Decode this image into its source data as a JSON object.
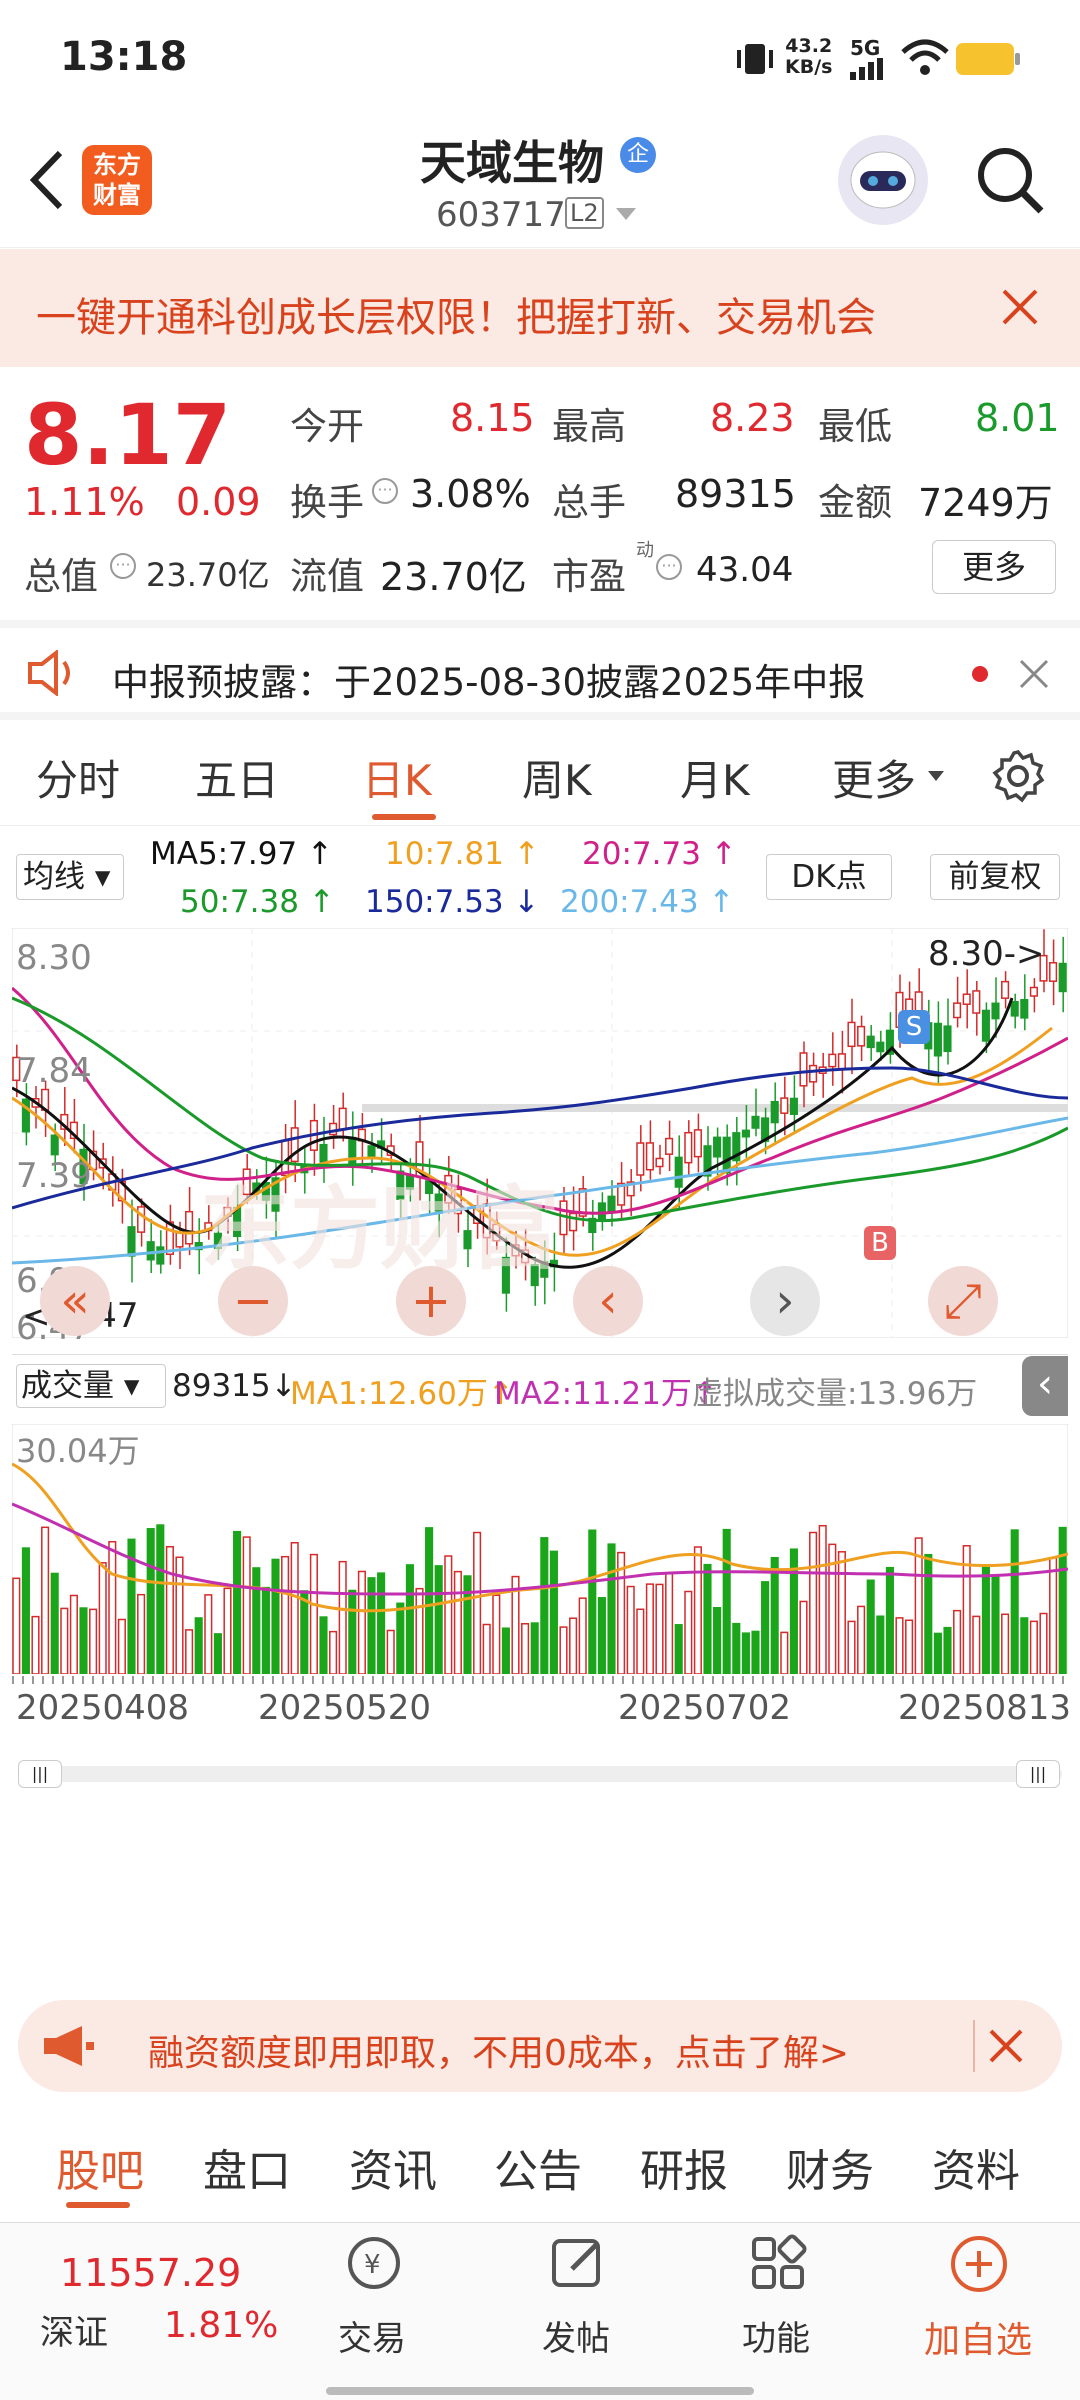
{
  "status": {
    "time": "13:18",
    "speed_top": "43.2",
    "speed_unit": "KB/s",
    "network": "5G"
  },
  "header": {
    "title": "天域生物",
    "badge": "企",
    "code": "603717",
    "level": "L2",
    "logo_top": "东方",
    "logo_bottom": "财富"
  },
  "banner": {
    "text": "一键开通科创成长层权限！把握打新、交易机会"
  },
  "quote": {
    "price": "8.17",
    "change_pct": "1.11%",
    "change": "0.09",
    "open_label": "今开",
    "open": "8.15",
    "high_label": "最高",
    "high": "8.23",
    "low_label": "最低",
    "low": "8.01",
    "turnover_label": "换手",
    "turnover": "3.08%",
    "volume_label": "总手",
    "volume": "89315",
    "amount_label": "金额",
    "amount": "7249万",
    "mktcap_label": "总值",
    "mktcap": "23.70亿",
    "float_label": "流值",
    "float": "23.70亿",
    "pe_label": "市盈",
    "pe_sup": "动",
    "pe": "43.04",
    "more": "更多"
  },
  "notice": {
    "text": "中报预披露：于2025-08-30披露2025年中报"
  },
  "tabs": [
    "分时",
    "五日",
    "日K",
    "周K",
    "月K",
    "更多"
  ],
  "ma": {
    "selector": "均线",
    "ma5": "MA5:7.97",
    "ma10": "10:7.81",
    "ma20": "20:7.73",
    "ma50": "50:7.38",
    "ma150": "150:7.53",
    "ma200": "200:7.43",
    "dk": "DK点",
    "fq": "前复权"
  },
  "colors": {
    "ma5": "#111111",
    "ma10": "#f0a020",
    "ma20": "#d0208a",
    "ma50": "#1a9a2a",
    "ma150": "#1a2a9a",
    "ma200": "#6ab8e8",
    "up": "#d42a2a",
    "down": "#1a9a2a",
    "accent": "#e05a30"
  },
  "price_axis": {
    "top": "8.30",
    "p2": "7.84",
    "p3": "7.39",
    "p4": "6.93",
    "bottom": "6.47",
    "max_marker": "8.30->",
    "min_marker": "<-6.47"
  },
  "volume": {
    "selector": "成交量",
    "value": "89315",
    "ma1": "MA1:12.60万",
    "ma2": "MA2:11.21万",
    "virtual": "虚拟成交量:13.96万",
    "max": "30.04万"
  },
  "dates": [
    "20250408",
    "20250520",
    "20250702",
    "20250813"
  ],
  "ad": {
    "text": "融资额度即用即取，不用0成本，点击了解>"
  },
  "subtabs": [
    "股吧",
    "盘口",
    "资讯",
    "公告",
    "研报",
    "财务",
    "资料"
  ],
  "bottom": {
    "index": "11557.29",
    "index_name": "深证",
    "index_pct": "1.81%",
    "trade": "交易",
    "post": "发帖",
    "func": "功能",
    "add": "加自选"
  },
  "watermark": "东方财富",
  "markers": {
    "sell": "S",
    "buy": "B"
  }
}
